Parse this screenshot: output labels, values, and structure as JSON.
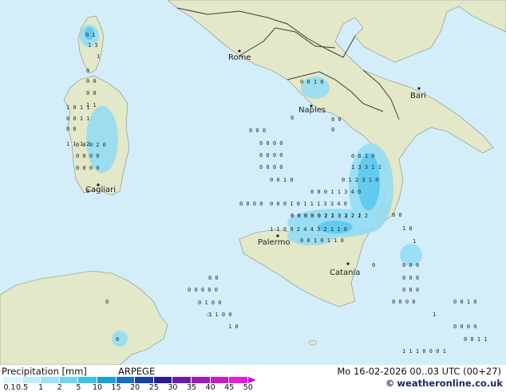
{
  "map": {
    "cities": [
      {
        "name": "Rome"
      },
      {
        "name": "Bari"
      },
      {
        "name": "Naples"
      },
      {
        "name": "Cagliari"
      },
      {
        "name": "Palermo"
      },
      {
        "name": "Catania"
      }
    ]
  },
  "footer": {
    "legend_title": "Precipitation [mm]",
    "model": "ARPEGE",
    "valid_time": "Mo 16-02-2026 00..03 UTC (00+27)",
    "credit": "weatheronline.co.uk",
    "copyright_symbol": "©"
  },
  "colorbar": {
    "labels": [
      "0.1",
      "0.5",
      "1",
      "2",
      "5",
      "10",
      "15",
      "20",
      "25",
      "30",
      "35",
      "40",
      "45",
      "50"
    ],
    "colors": [
      "#dcf5ff",
      "#bfeefc",
      "#9ae4f8",
      "#6fd4f2",
      "#3ec0ea",
      "#1e9fd8",
      "#1a6fc0",
      "#1a40a8",
      "#2a1c98",
      "#6a1ca8",
      "#9c1cb8",
      "#c81cc8",
      "#e21ed8"
    ]
  },
  "colors": {
    "sea": "#d3eef9",
    "land": "#e2e8c8",
    "border": "#3c3c3c"
  },
  "precip_grid": [
    "0 1",
    "1 3",
    "1",
    "0",
    "0 0",
    "0 0",
    "1 1",
    "1 0 1 1",
    "0 0 1 1",
    "0 0",
    "1 1 1 2",
    "0 0 0 2 0",
    "0 0 0 0",
    "0 0 0 0",
    "0",
    "0 0 1 0",
    "0",
    "0 0",
    "0",
    "0 0 0",
    "0 0 0 0",
    "0 0 0 0",
    "0 0 0 0",
    "0 0 1 0",
    "0 0 1 0",
    "0 1 2 3 1 0",
    "0 0 0 1 1 3 4 0",
    "0 0 0 0",
    "1 3 3 1 1",
    "0 0 0 1 0 1 1 1 3 3 4 0",
    "0 0 0 0 0 1 2 3 3 2 1",
    "0 0 0 0 0 2 1 3 2 2 2 2",
    "1 1 0 0 2 4 4 3 2 1 1 0",
    "0 0 1 0 1 1 0",
    "1 0",
    "1",
    "0",
    "0 0",
    "0 0",
    "0 0 0 0 0",
    "0 1 0 0",
    "1 1 0 0",
    "1 0",
    "0",
    "0",
    "0 0 0",
    "0 0 0",
    "0 0 0",
    "0 0 0 0",
    "1",
    "0 0 1 0",
    "0 0 0 0",
    "0 0 1 1",
    "1 1 1 0 0 0 1"
  ]
}
